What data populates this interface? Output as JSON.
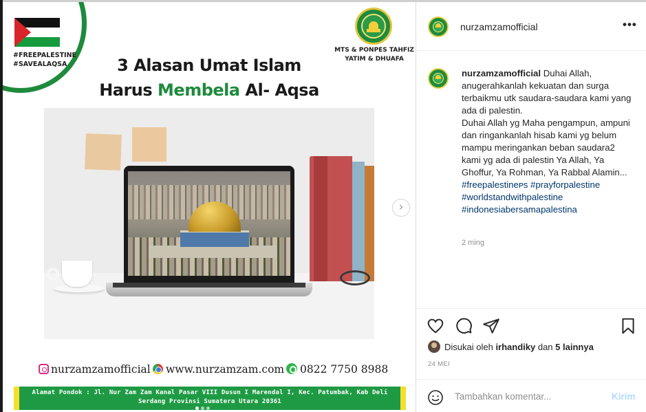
{
  "post_image": {
    "hashtags": [
      "#FREEPALESTINE",
      "#SAVEALAQSA"
    ],
    "school_name": [
      "MTS & PONPES TAHFIZ",
      "YATIM & DHUAFA"
    ],
    "headline_line1": "3 Alasan Umat Islam",
    "headline_line2_pre": "Harus ",
    "headline_line2_highlight": "Membela",
    "headline_line2_post": " Al- Aqsa",
    "contact_instagram": "nurzamzamofficial",
    "contact_website": "www.nurzamzam.com",
    "contact_phone": "0822 7750 8988",
    "address_line1": "Alamat Pondok : Jl. Nur Zam Zam Kanal Pasar VIII Dusun I Marendal I, Kec. Patumbak, Kab Deli",
    "address_line2": "Serdang Provinsi Sumatera Utara 20361",
    "next_glyph": "›",
    "accent_green": "#1e8a3c",
    "flag_colors": [
      "#111111",
      "#ffffff",
      "#159a3c",
      "#d9242a"
    ]
  },
  "header": {
    "username": "nurzamzamofficial",
    "more_glyph": "•••"
  },
  "caption": {
    "username": "nurzamzamofficial",
    "text_para1": "Duhai Allah, anugerahkanlah kekuatan dan surga terbaikmu utk saudara-saudara kami yang ada di palestin.",
    "text_para2": "Duhai Allah yg Maha pengampun, ampuni dan ringankanlah hisab kami yg belum mampu meringankan beban saudara2 kami yg ada di palestin Ya Allah, Ya Ghoffur, Ya Rohman, Ya Rabbal Alamin...",
    "hashtags": [
      "#freepalestineᴘs",
      "#prayforpalestine",
      "#worldstandwithpalestine",
      "#indonesiabersamapalestina"
    ],
    "time_ago": "2 ming"
  },
  "likes": {
    "prefix": "Disukai oleh ",
    "user": "irhandiky",
    "middle": " dan ",
    "others": "5 lainnya"
  },
  "date": "24 MEI",
  "comment": {
    "placeholder": "Tambahkan komentar...",
    "post_label": "Kirim"
  },
  "icons": [
    "heart-icon",
    "comment-icon",
    "share-icon",
    "bookmark-icon",
    "emoji-icon",
    "more-icon",
    "next-arrow-icon"
  ]
}
